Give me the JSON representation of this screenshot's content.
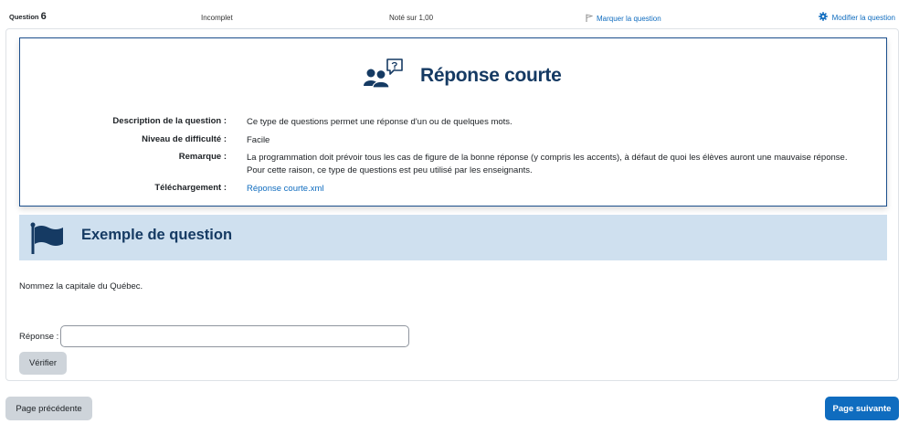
{
  "question_info": {
    "label": "Question",
    "number": "6",
    "state": "Incomplet",
    "grade": "Noté sur 1,00",
    "flag_label": "Marquer la question",
    "edit_label": "Modifier la question"
  },
  "info_box": {
    "title": "Réponse courte",
    "rows": [
      {
        "label": "Description de la question :",
        "value": "Ce type de questions permet une réponse d'un ou de quelques mots."
      },
      {
        "label": "Niveau de difficulté :",
        "value": "Facile"
      },
      {
        "label": "Remarque :",
        "value_line1": "La programmation doit prévoir tous les cas de figure de la bonne réponse (y compris les accents), à défaut de quoi les élèves auront une mauvaise réponse.",
        "value_line2": "Pour cette raison, ce type de questions est peu utilisé par les enseignants."
      },
      {
        "label": "Téléchargement :",
        "value": "Réponse courte.xml"
      }
    ]
  },
  "example": {
    "title": "Exemple de question"
  },
  "question": {
    "text": "Nommez la capitale du Québec.",
    "answer_label": "Réponse :",
    "answer_value": "",
    "check_label": "Vérifier"
  },
  "navigation": {
    "prev_label": "Page précédente",
    "next_label": "Page suivante"
  },
  "colors": {
    "accent": "#0f6cbf",
    "navy": "#153a63",
    "banner": "#cfe0ef",
    "button_gray": "#ced4da"
  }
}
